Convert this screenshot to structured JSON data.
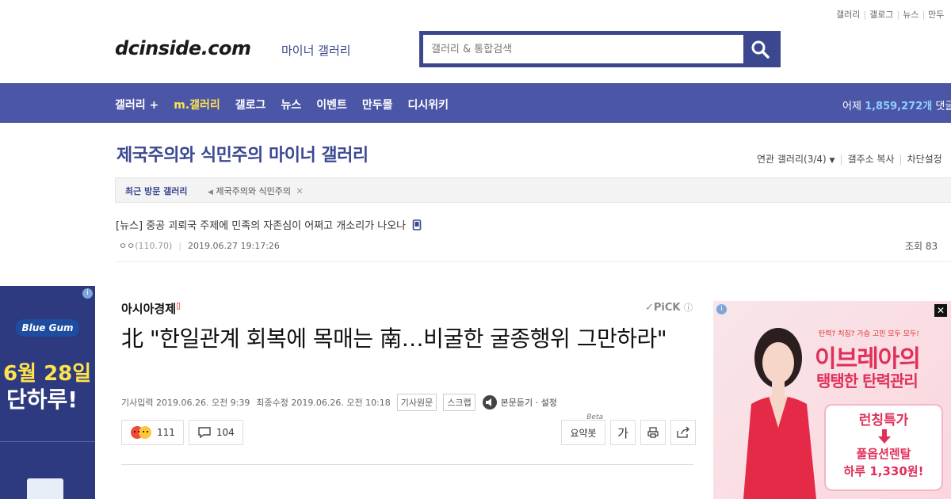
{
  "top_links": [
    "갤러리",
    "갤로그",
    "뉴스",
    "만두"
  ],
  "logo": {
    "text": "dcinside.com",
    "subtitle": "마이너 갤러리"
  },
  "search": {
    "placeholder": "갤러리 & 통합검색"
  },
  "nav": {
    "items": [
      "갤러리 +",
      "m.갤러리",
      "갤로그",
      "뉴스",
      "이벤트",
      "만두몰",
      "디시위키"
    ],
    "stat_prefix": "어제",
    "stat_value": "1,859,272개",
    "stat_suffix": "댓글"
  },
  "gallery": {
    "title": "제국주의와 식민주의 마이너 갤러리",
    "tools": [
      "연관 갤러리(3/4)",
      "갤주소 복사",
      "차단설정"
    ]
  },
  "recent": {
    "label": "최근 방문 갤러리",
    "item": "제국주의와 식민주의"
  },
  "post": {
    "title": "[뉴스] 중공 괴뢰국 주제에 민족의 자존심이 어쩌고 개소리가 나오나",
    "author": "ㅇㅇ",
    "ip": "(110.70)",
    "date": "2019.06.27 19:17:26",
    "views": "조회 83"
  },
  "left_ad": {
    "brand": "Blue Gum",
    "line1": "6월 28일",
    "line2": "단하루!"
  },
  "article": {
    "source": "아시아경제",
    "pick": "PiCK",
    "title": "北 \"한일관계 회복에 목매는 南…비굴한 굴종행위 그만하라\"",
    "date_input": "기사입력 2019.06.26. 오전 9:39",
    "date_modified": "최종수정 2019.06.26. 오전 10:18",
    "btn_original": "기사원문",
    "btn_scrap": "스크랩",
    "listen": "본문듣기 · 설정",
    "reaction_count": "111",
    "comment_count": "104",
    "summary": "요약봇",
    "summary_beta": "Beta",
    "font_btn": "가"
  },
  "right_ad": {
    "tagline": "탄력? 처짐? 가슴 고민 모두 모두!",
    "headline1": "이브레아의",
    "headline2": "탱탱한 탄력관리",
    "promo1": "런칭특가",
    "promo2": "풀옵션렌탈\n하루 1,330원!"
  },
  "colors": {
    "brand": "#3b4890",
    "nav": "#4b56a7",
    "highlight": "#ffe34d",
    "ad_pink": "#e0305a"
  }
}
